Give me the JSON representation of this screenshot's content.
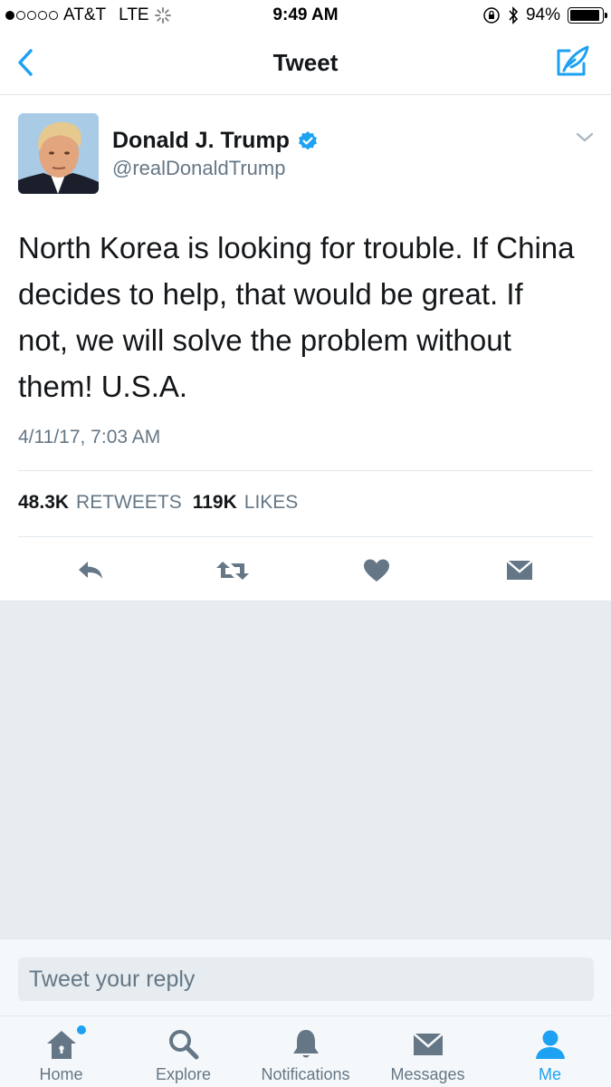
{
  "status_bar": {
    "carrier": "AT&T",
    "network": "LTE",
    "time": "9:49 AM",
    "battery_percent": "94%",
    "battery_level": 0.94,
    "signal_bars_filled": 1,
    "signal_bars_total": 5
  },
  "nav": {
    "title": "Tweet",
    "back_icon": "chevron-left-icon",
    "compose_icon": "compose-feather-icon"
  },
  "tweet": {
    "display_name": "Donald J. Trump",
    "handle": "@realDonaldTrump",
    "verified": true,
    "text": "North Korea is looking for trouble. If China\ndecides to help, that would be great. If\nnot, we will solve the problem without\nthem!  U.S.A.",
    "timestamp": "4/11/17, 7:03 AM",
    "retweets_count": "48.3K",
    "retweets_label": "RETWEETS",
    "likes_count": "119K",
    "likes_label": "LIKES"
  },
  "actions": [
    "reply-icon",
    "retweet-icon",
    "heart-icon",
    "direct-message-icon"
  ],
  "reply": {
    "placeholder": "Tweet your reply"
  },
  "tabs": [
    {
      "label": "Home",
      "icon": "home-icon",
      "has_badge": true
    },
    {
      "label": "Explore",
      "icon": "search-icon"
    },
    {
      "label": "Notifications",
      "icon": "bell-icon"
    },
    {
      "label": "Messages",
      "icon": "envelope-icon"
    },
    {
      "label": "Me",
      "icon": "person-icon",
      "active": true
    }
  ],
  "colors": {
    "accent": "#1da1f2",
    "text_primary": "#14171a",
    "text_secondary": "#657786",
    "action_icon": "#657786",
    "background": "#e6ecf0"
  }
}
